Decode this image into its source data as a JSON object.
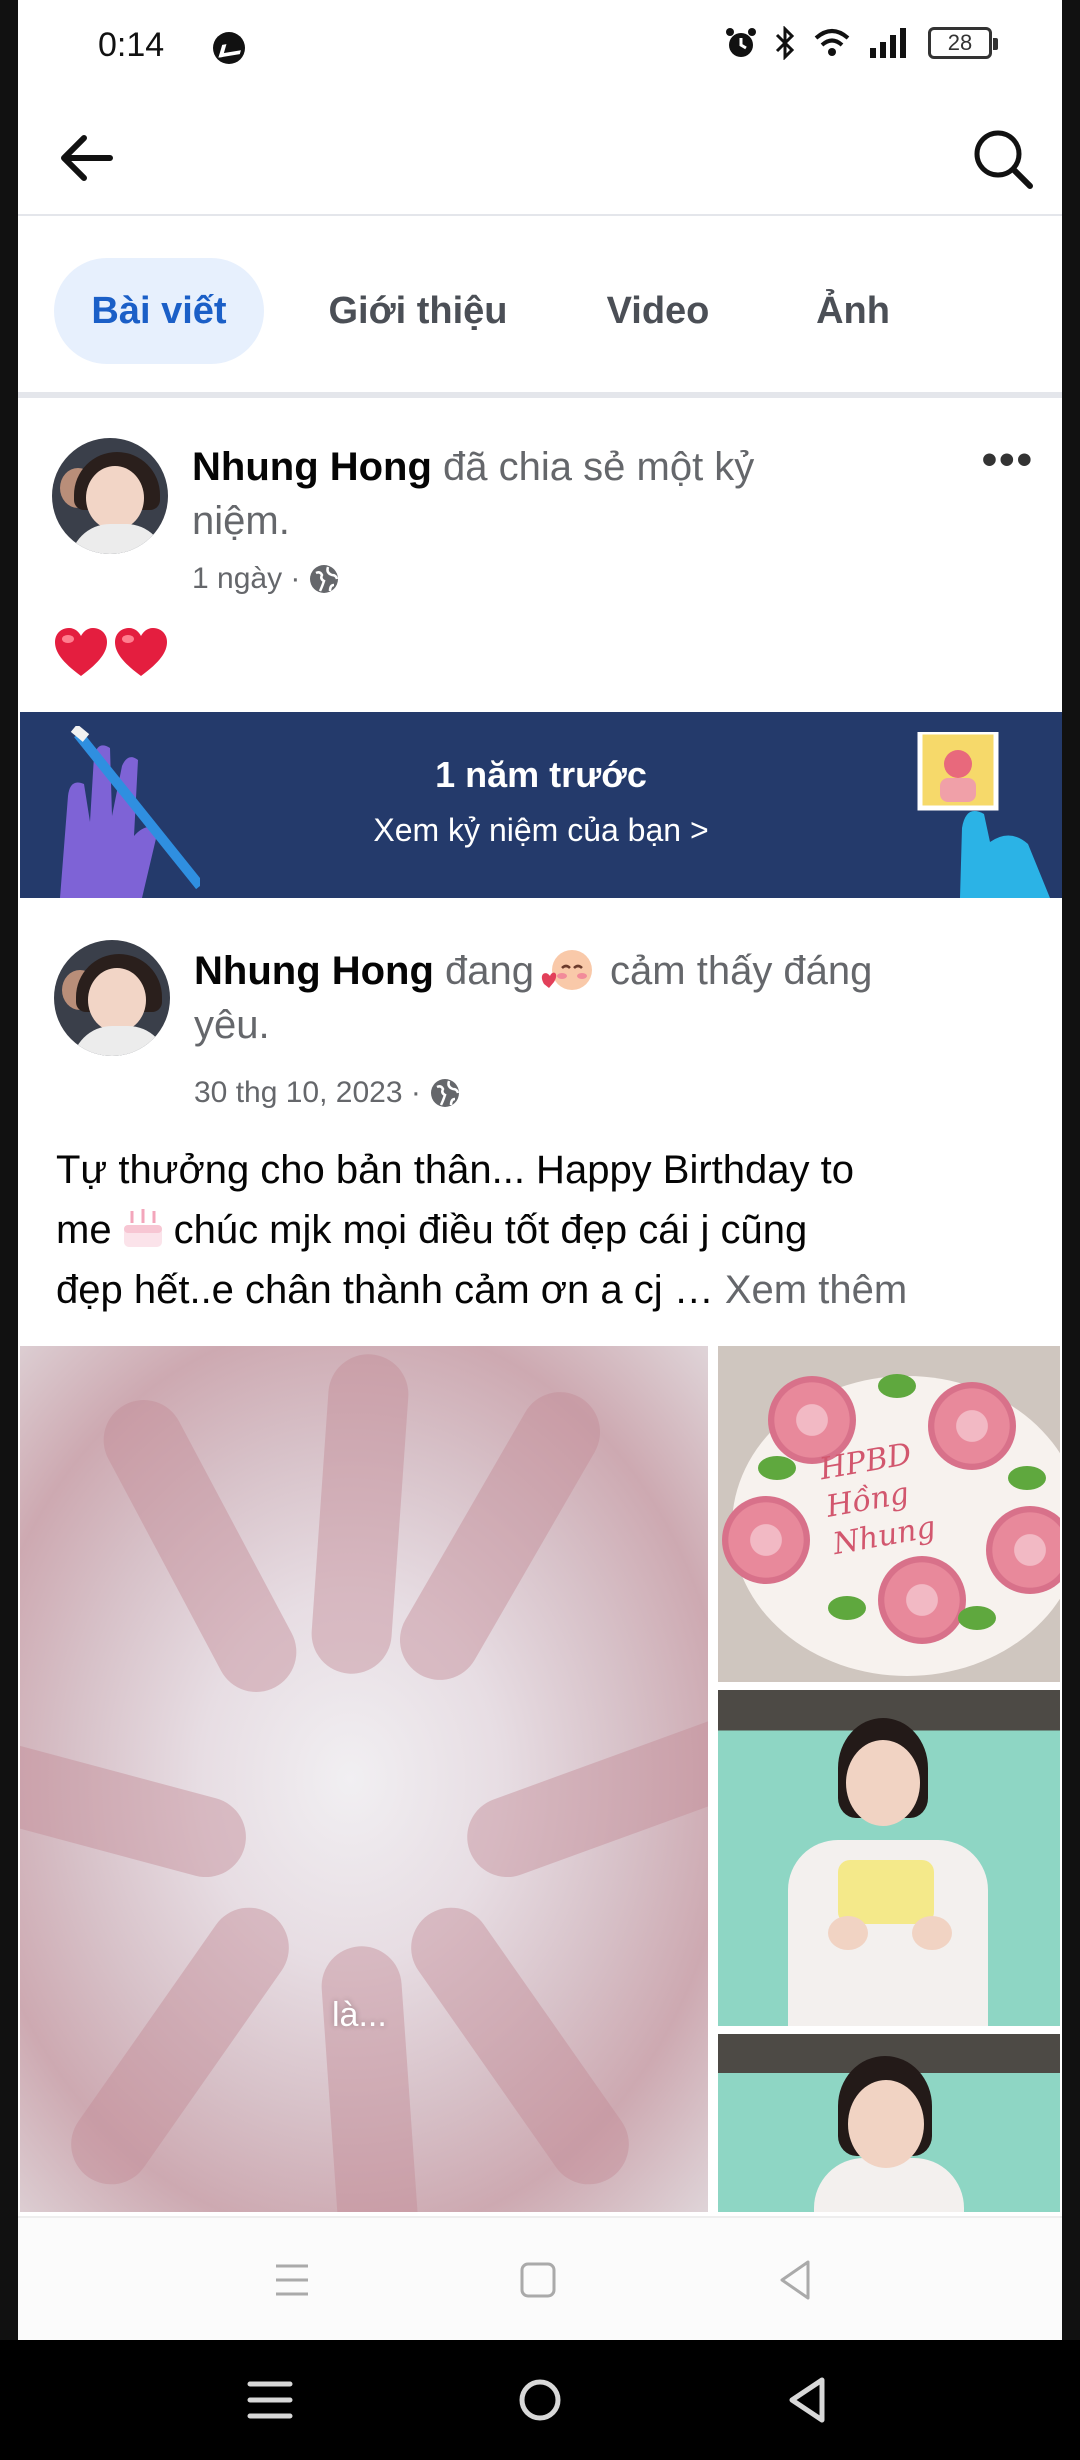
{
  "status_bar": {
    "time": "0:14",
    "battery": "28"
  },
  "header": {
    "back_label": "",
    "search_label": ""
  },
  "tabs": [
    {
      "label": "Bài viết",
      "active": true
    },
    {
      "label": "Giới thiệu",
      "active": false
    },
    {
      "label": "Video",
      "active": false
    },
    {
      "label": "Ảnh",
      "active": false
    }
  ],
  "post1": {
    "author": "Nhung Hong",
    "action_line1": "đã chia sẻ một kỷ",
    "action_line2": "niệm.",
    "time": "1 ngày ·",
    "privacy_icon": "globe-icon",
    "reaction_icons": [
      "red-heart-icon",
      "red-heart-icon"
    ]
  },
  "memory": {
    "title": "1 năm trước",
    "link": "Xem kỷ niệm của bạn >"
  },
  "post2": {
    "author": "Nhung Hong",
    "feeling_before": "đang",
    "feeling_icon": "blushing-face-icon",
    "feeling_after": "cảm thấy đáng",
    "feeling_line2": "yêu.",
    "time": "30 thg 10, 2023 ·",
    "privacy_icon": "globe-icon",
    "body_line1": "Tự thưởng cho bản thân... Happy Birthday to",
    "body_line2_a": "me",
    "body_line2_b": "chúc mjk mọi điều tốt đẹp cái j cũng",
    "body_line3": "đẹp hết..e chân thành cảm ơn a cj …",
    "see_more": "Xem thêm",
    "photo_caption": "là...",
    "cake_text": [
      "HPBD",
      "Hồng",
      "Nhung"
    ]
  },
  "colors": {
    "accent": "#1b5fc7",
    "tab_active_bg": "#e7f0fd",
    "banner_bg": "#243a6b",
    "heart": "#e41e3f"
  }
}
